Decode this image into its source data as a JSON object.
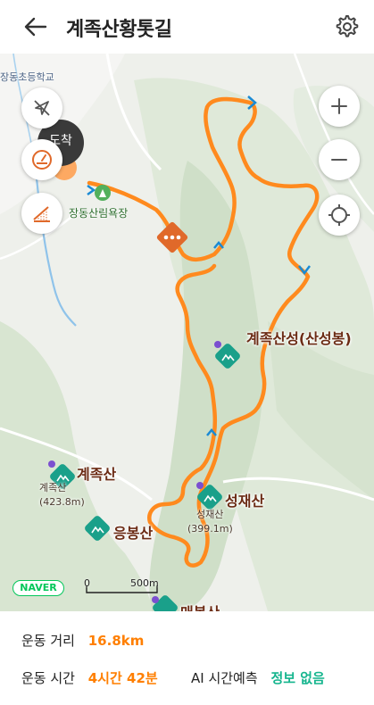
{
  "header": {
    "title": "계족산황톳길",
    "back_icon": "arrow-left-icon",
    "settings_icon": "gear-icon"
  },
  "map": {
    "controls_left": [
      {
        "name": "compass-off-icon"
      },
      {
        "name": "speedometer-icon"
      },
      {
        "name": "elevation-graph-icon"
      }
    ],
    "controls_right": [
      {
        "name": "zoom-in-icon",
        "glyph": "+"
      },
      {
        "name": "zoom-out-icon",
        "glyph": "−"
      },
      {
        "name": "current-location-icon"
      }
    ],
    "arrive_badge": "도착",
    "labels": {
      "school": "장동초등학교",
      "forest": "장동산림욕장",
      "fortress": "계족산성(산성봉)",
      "gyejoksan": "계족산",
      "gyejoksan_sub": "계족산",
      "gyejoksan_height": "(423.8m)",
      "eungbongsan": "응봉산",
      "seongjaesan": "성재산",
      "seongjaesan_sub": "성재산",
      "seongjaesan_height": "(399.1m)",
      "maebongsan": "매봉산"
    },
    "naver_logo": "NAVER",
    "scale": {
      "left": "0",
      "right": "500m"
    },
    "route_color": "#ff8a1e"
  },
  "stats": {
    "distance_label": "운동 거리",
    "distance_value": "16.8km",
    "time_label": "운동 시간",
    "time_value": "4시간 42분",
    "ai_label": "AI 시간예측",
    "ai_value": "정보 없음"
  }
}
